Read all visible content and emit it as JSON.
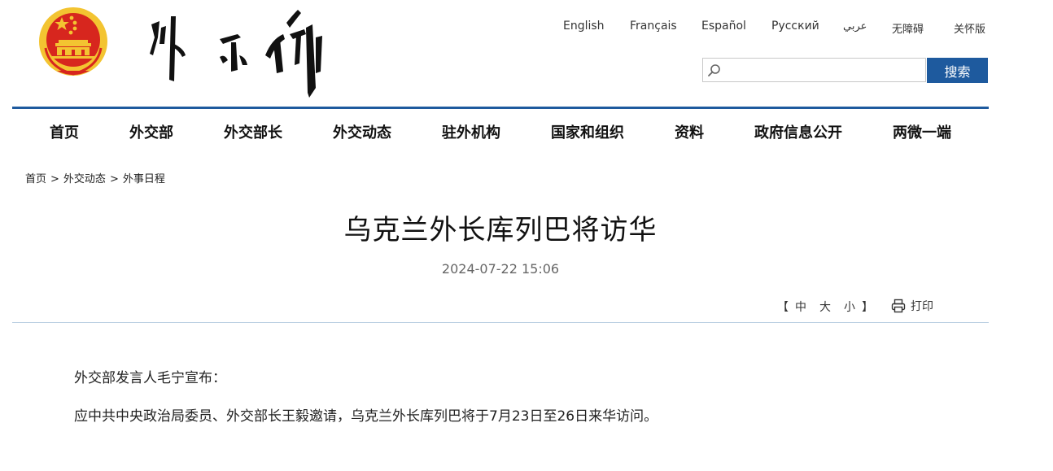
{
  "header": {
    "languages": [
      "English",
      "Français",
      "Español",
      "Русский",
      "عربي",
      "无障碍",
      "关怀版"
    ],
    "search": {
      "placeholder": "",
      "button_label": "搜索"
    }
  },
  "nav": {
    "items": [
      "首页",
      "外交部",
      "外交部长",
      "外交动态",
      "驻外机构",
      "国家和组织",
      "资料",
      "政府信息公开",
      "两微一端"
    ]
  },
  "breadcrumb": {
    "items": [
      "首页",
      "外交动态",
      "外事日程"
    ],
    "separator": ">"
  },
  "article": {
    "title": "乌克兰外长库列巴将访华",
    "publish_time": "2024-07-22 15:06",
    "font_size": {
      "open": "【",
      "options": [
        "中",
        "大",
        "小"
      ],
      "close": "】"
    },
    "print_label": "打印",
    "paragraphs": [
      "外交部发言人毛宁宣布：",
      "应中共中央政治局委员、外交部长王毅邀请，乌克兰外长库列巴将于7月23日至26日来华访问。"
    ]
  },
  "colors": {
    "accent": "#1e5a9e",
    "emblem_red": "#d7261e",
    "emblem_gold": "#f3c431",
    "rule_light": "#b9cfe2"
  }
}
